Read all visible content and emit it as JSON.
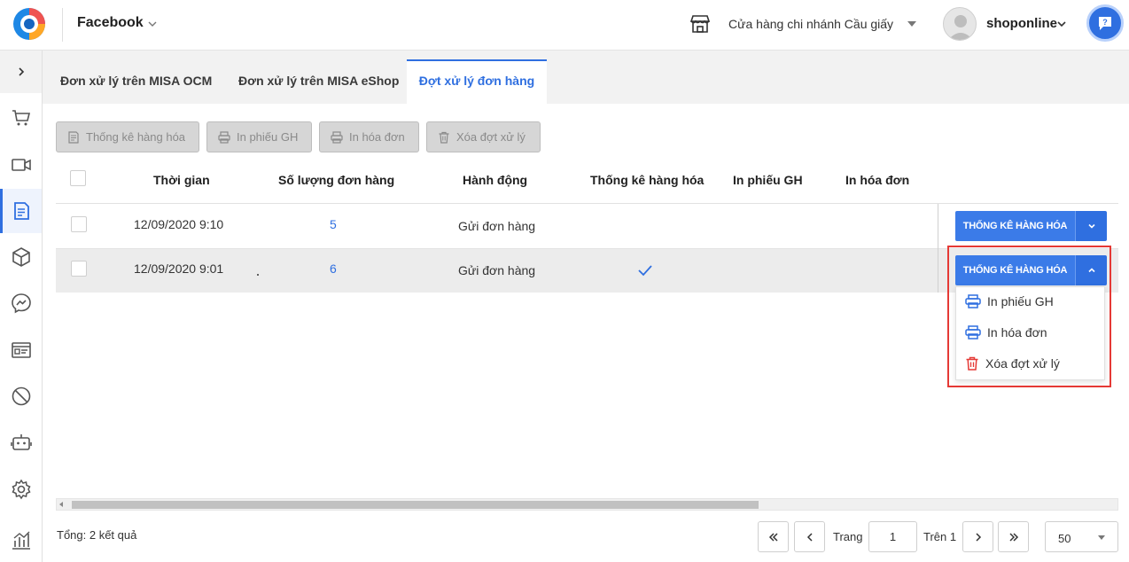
{
  "header": {
    "channel": "Facebook",
    "store_name": "Cửa hàng chi nhánh Cầu giấy",
    "username": "shoponline"
  },
  "tabs": [
    {
      "label": "Đơn xử lý trên MISA OCM",
      "active": false
    },
    {
      "label": "Đơn xử lý trên MISA eShop",
      "active": false
    },
    {
      "label": "Đợt xử lý đơn hàng",
      "active": true
    }
  ],
  "toolbar": {
    "stats": "Thống kê hàng hóa",
    "print_delivery": "In phiếu GH",
    "print_invoice": "In hóa đơn",
    "delete_batch": "Xóa đợt xử lý"
  },
  "table": {
    "columns": [
      "Thời gian",
      "Số lượng đơn hàng",
      "Hành động",
      "Thống kê hàng hóa",
      "In phiếu GH",
      "In hóa đơn"
    ],
    "rows": [
      {
        "time": "12/09/2020 9:10",
        "count": "5",
        "action": "Gửi đơn hàng",
        "stats_done": false,
        "button": "THỐNG KÊ HÀNG HÓA"
      },
      {
        "time": "12/09/2020 9:01",
        "count": "6",
        "action": "Gửi đơn hàng",
        "stats_done": true,
        "button": "THỐNG KÊ HÀNG HÓA"
      }
    ]
  },
  "dropdown_menu": {
    "items": [
      {
        "label": "In phiếu GH",
        "icon": "printer-icon"
      },
      {
        "label": "In hóa đơn",
        "icon": "printer-icon"
      },
      {
        "label": "Xóa đợt xử lý",
        "icon": "trash-icon"
      }
    ]
  },
  "footer": {
    "total": "Tổng: 2 kết quả",
    "page_label": "Trang",
    "page": "1",
    "of_label": "Trên 1",
    "page_size": "50"
  },
  "colors": {
    "accent": "#2f6fe0",
    "danger": "#e53935",
    "disabled_btn": "#d6d6d6"
  }
}
